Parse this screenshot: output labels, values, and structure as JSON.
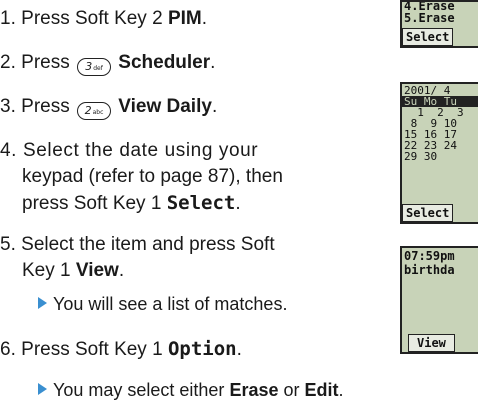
{
  "steps": {
    "s1": {
      "num": "1.",
      "pre": "Press Soft Key 2 ",
      "bold": "PIM",
      "post": "."
    },
    "s2": {
      "num": "2.",
      "pre": "Press ",
      "key_digit": "3",
      "key_sub": "def",
      "bold": "Scheduler",
      "post": "."
    },
    "s3": {
      "num": "3.",
      "pre": "Press ",
      "key_digit": "2",
      "key_sub": "abc",
      "bold": "View Daily",
      "post": "."
    },
    "s4": {
      "num": "4.",
      "line1": "Select the date using your",
      "line2": "keypad (refer to page 87), then",
      "line3_pre": "press Soft Key 1 ",
      "line3_bold": "Select",
      "line3_post": "."
    },
    "s5": {
      "num": "5.",
      "line1": "Select the item and press Soft",
      "line2_pre": "Key 1 ",
      "line2_bold": "View",
      "line2_post": ".",
      "note": "You will see a list of matches."
    },
    "s6": {
      "num": "6.",
      "pre": "Press Soft Key 1 ",
      "bold": "Option",
      "post": ".",
      "note_pre": "You may select either ",
      "note_b1": "Erase",
      "note_mid": " or ",
      "note_b2": "Edit",
      "note_post": "."
    }
  },
  "screens": {
    "screen1": {
      "line1": "4.Erase",
      "line2": "5.Erase",
      "softkey": "Select"
    },
    "screen2": {
      "header": "2001/ 4",
      "days": "Su Mo Tu",
      "rows": [
        "  1  2  3",
        " 8  9 10",
        "15 16 17",
        "22 23 24",
        "29 30"
      ],
      "softkey": "Select"
    },
    "screen3": {
      "line1": "07:59pm",
      "line2": "birthda",
      "softkey": "View"
    }
  },
  "colors": {
    "lcd_bg": "#c8d3b8",
    "bullet_arrow": "#3a8fd0"
  }
}
